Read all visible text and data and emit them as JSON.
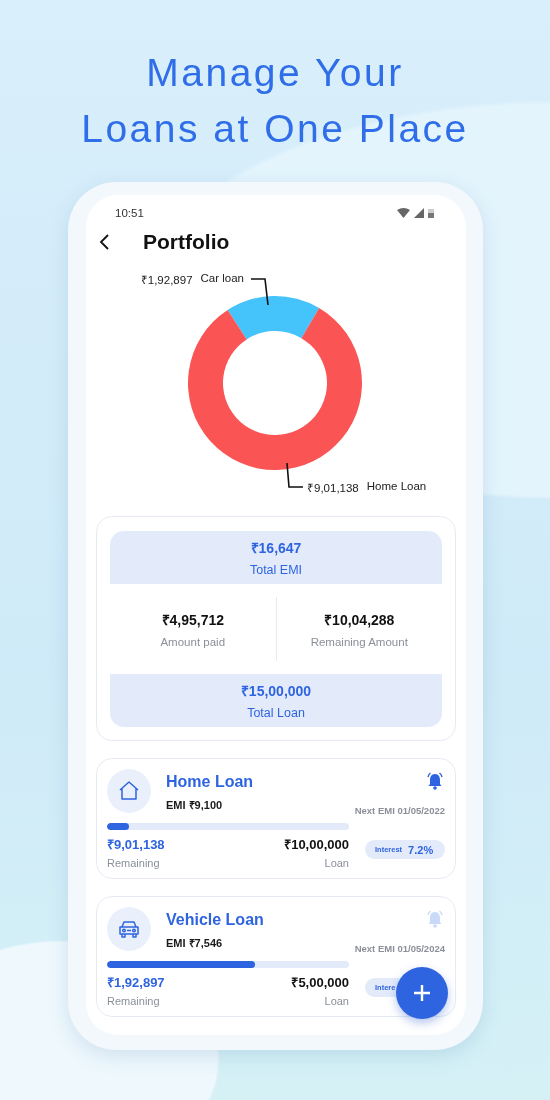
{
  "headline": [
    "Manage Your",
    "Loans at One Place"
  ],
  "status_bar": {
    "time": "10:51"
  },
  "header": {
    "title": "Portfolio"
  },
  "chart_data": {
    "type": "donut",
    "categories": [
      "Car loan",
      "Home Loan"
    ],
    "values": [
      17.63,
      82.37
    ],
    "colors": [
      "#45c3fb",
      "#fb5454"
    ]
  },
  "slice_amounts": [
    "₹1,92,897",
    "₹9,01,138"
  ],
  "summary": {
    "total_emi": {
      "value": "₹16,647",
      "label": "Total EMI"
    },
    "amount_paid": {
      "value": "₹4,95,712",
      "label": "Amount paid"
    },
    "remaining_amount": {
      "value": "₹10,04,288",
      "label": "Remaining Amount"
    },
    "total_loan": {
      "value": "₹15,00,000",
      "label": "Total Loan"
    }
  },
  "loans": [
    {
      "kind": "home",
      "title": "Home Loan",
      "emi": "EMI ₹9,100",
      "alert": true,
      "next_emi": "Next EMI 01/05/2022",
      "level": 0.09,
      "remaining": "₹9,01,138",
      "remaining_label": "Remaining",
      "loan": "₹10,00,000",
      "loan_label": "Loan",
      "interest_label": "Interest",
      "interest": "7.2%"
    },
    {
      "kind": "vehicle",
      "title": "Vehicle Loan",
      "emi": "EMI ₹7,546",
      "alert": false,
      "next_emi": "Next EMI 01/05/2024",
      "level": 0.61,
      "remaining": "₹1,92,897",
      "remaining_label": "Remaining",
      "loan": "₹5,00,000",
      "loan_label": "Loan",
      "interest_label": "Intere"
    }
  ]
}
